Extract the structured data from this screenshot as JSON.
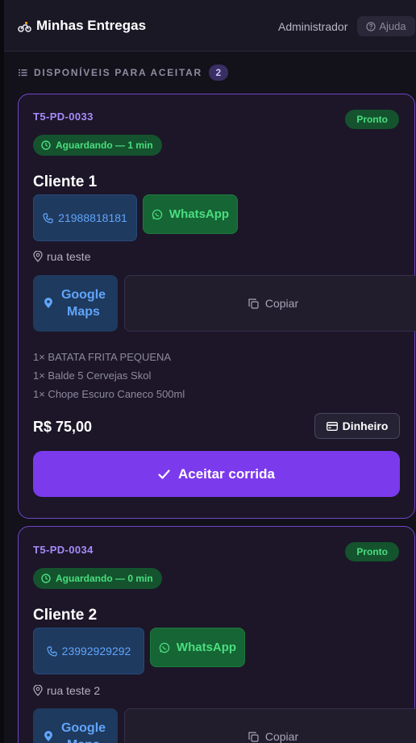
{
  "header": {
    "title": "Minhas Entregas",
    "title_icon": "motorcycle-icon",
    "role": "Administrador",
    "help_label": "Ajuda",
    "help_icon": "question-circle-icon"
  },
  "section": {
    "title": "DISPONÍVEIS PARA ACEITAR",
    "count": "2",
    "icon": "list-icon"
  },
  "cards": [
    {
      "code": "T5-PD-0033",
      "status": "Pronto",
      "waiting": "Aguardando — 1 min",
      "client": "Cliente 1",
      "phone": "21988818181",
      "whatsapp": "WhatsApp",
      "address": "rua teste",
      "maps": "Google Maps",
      "copy": "Copiar",
      "items": [
        "1× BATATA FRITA PEQUENA",
        "1× Balde 5 Cervejas Skol",
        "1× Chope Escuro Caneco 500ml"
      ],
      "total": "R$ 75,00",
      "payment": "Dinheiro",
      "accept": "Aceitar corrida"
    },
    {
      "code": "T5-PD-0034",
      "status": "Pronto",
      "waiting": "Aguardando — 0 min",
      "client": "Cliente 2",
      "phone": "23992929292",
      "whatsapp": "WhatsApp",
      "address": "rua teste 2",
      "maps": "Google Maps",
      "copy": "Copiar"
    }
  ],
  "colors": {
    "background": "#131119",
    "card": "#1c1628",
    "accent": "#7c3aed",
    "status_green": "#4ade80",
    "link_blue": "#60a5fa"
  }
}
